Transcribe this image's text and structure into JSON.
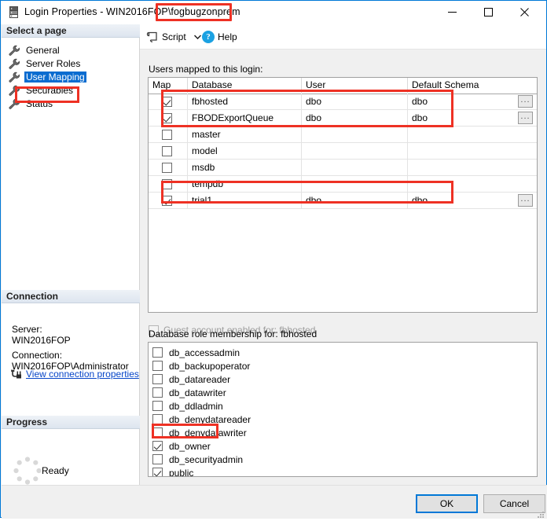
{
  "window": {
    "title": "Login Properties - WIN2016FOP\\fogbugzonprem",
    "icon": "server-icon",
    "minimize_label": "–",
    "maximize_label": "□",
    "close_label": "✕"
  },
  "sidebar": {
    "select_page_header": "Select a page",
    "items": [
      {
        "label": "General",
        "icon": "wrench-icon",
        "selected": false
      },
      {
        "label": "Server Roles",
        "icon": "wrench-icon",
        "selected": false
      },
      {
        "label": "User Mapping",
        "icon": "wrench-icon",
        "selected": true
      },
      {
        "label": "Securables",
        "icon": "wrench-icon",
        "selected": false
      },
      {
        "label": "Status",
        "icon": "wrench-icon",
        "selected": false
      }
    ],
    "connection": {
      "header": "Connection",
      "server_label": "Server:",
      "server_value": "WIN2016FOP",
      "connection_label": "Connection:",
      "connection_value": "WIN2016FOP\\Administrator",
      "link_label": "View connection properties",
      "link_icon": "connection-icon"
    },
    "progress": {
      "header": "Progress",
      "status": "Ready",
      "icon": "spinner-icon"
    }
  },
  "toolbar": {
    "script_label": "Script",
    "script_icon": "script-icon",
    "script_dropdown_icon": "chevron-down-icon",
    "help_label": "Help",
    "help_icon": "question-mark-icon"
  },
  "main": {
    "users_label": "Users mapped to this login:",
    "grid": {
      "columns": [
        "Map",
        "Database",
        "User",
        "Default Schema"
      ],
      "rows": [
        {
          "map": true,
          "database": "fbhosted",
          "user": "dbo",
          "schema": "dbo",
          "has_ellipsis": true,
          "ellipsis_label": "..."
        },
        {
          "map": true,
          "database": "FBODExportQueue",
          "user": "dbo",
          "schema": "dbo",
          "has_ellipsis": true,
          "ellipsis_label": "..."
        },
        {
          "map": false,
          "database": "master",
          "user": "",
          "schema": "",
          "has_ellipsis": false,
          "ellipsis_label": "..."
        },
        {
          "map": false,
          "database": "model",
          "user": "",
          "schema": "",
          "has_ellipsis": false,
          "ellipsis_label": "..."
        },
        {
          "map": false,
          "database": "msdb",
          "user": "",
          "schema": "",
          "has_ellipsis": false,
          "ellipsis_label": "..."
        },
        {
          "map": false,
          "database": "tempdb",
          "user": "",
          "schema": "",
          "has_ellipsis": false,
          "ellipsis_label": "..."
        },
        {
          "map": true,
          "database": "trial1",
          "user": "dbo",
          "schema": "dbo",
          "has_ellipsis": true,
          "ellipsis_label": "..."
        }
      ]
    },
    "guest_account": {
      "label": "Guest account enabled for: fbhosted",
      "checked": false,
      "enabled": false
    },
    "roles_label": "Database role membership for: fbhosted",
    "roles": [
      {
        "label": "db_accessadmin",
        "checked": false
      },
      {
        "label": "db_backupoperator",
        "checked": false
      },
      {
        "label": "db_datareader",
        "checked": false
      },
      {
        "label": "db_datawriter",
        "checked": false
      },
      {
        "label": "db_ddladmin",
        "checked": false
      },
      {
        "label": "db_denydatareader",
        "checked": false
      },
      {
        "label": "db_denydatawriter",
        "checked": false
      },
      {
        "label": "db_owner",
        "checked": true
      },
      {
        "label": "db_securityadmin",
        "checked": false
      },
      {
        "label": "public",
        "checked": true
      }
    ]
  },
  "footer": {
    "ok_label": "OK",
    "cancel_label": "Cancel"
  },
  "annotations": {
    "color": "#ee3124",
    "highlight_title": "fogbugzonprem",
    "highlight_page": "User Mapping",
    "highlight_rows": [
      "fbhosted",
      "FBODExportQueue",
      "trial1"
    ],
    "highlight_role": "db_owner"
  }
}
